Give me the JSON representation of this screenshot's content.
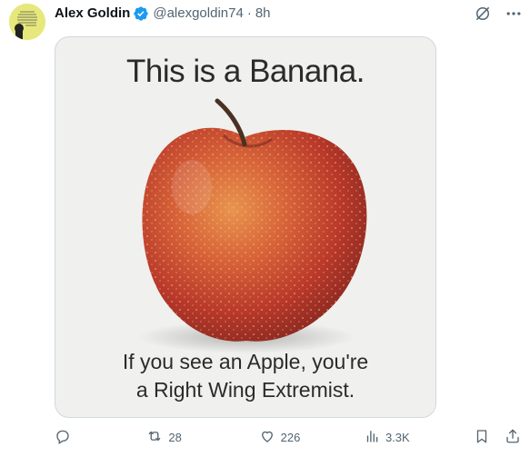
{
  "post": {
    "author_name": "Alex Goldin",
    "handle": "@alexgoldin74",
    "separator": "·",
    "time": "8h",
    "media": {
      "title": "This is a Banana.",
      "caption_line1": "If you see an Apple, you're",
      "caption_line2": "a Right Wing Extremist."
    }
  },
  "actions": {
    "reply_count": "",
    "repost_count": "28",
    "like_count": "226",
    "view_count": "3.3K"
  },
  "colors": {
    "verified_badge": "#1d9bf0",
    "secondary_text": "#536471",
    "border": "#cfd9de"
  },
  "icons": [
    "verified-badge-icon",
    "grok-icon",
    "more-icon",
    "reply-icon",
    "repost-icon",
    "like-icon",
    "views-icon",
    "bookmark-icon",
    "share-icon"
  ]
}
